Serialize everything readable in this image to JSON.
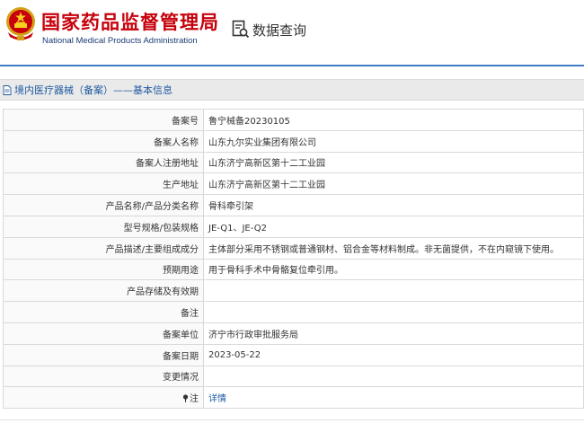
{
  "header": {
    "org_name_cn": "国家药品监督管理局",
    "org_name_en": "National Medical Products Administration",
    "query_label": "数据查询",
    "colors": {
      "brand_red": "#c7000b",
      "brand_blue": "#1a3a73",
      "divider": "#3e7dc3"
    },
    "emblem_icon": "national-emblem-icon",
    "query_icon": "document-search-icon"
  },
  "section": {
    "title": "境内医疗器械（备案）——基本信息",
    "icon": "document-icon"
  },
  "rows": [
    {
      "label": "备案号",
      "value": "鲁宁械备20230105"
    },
    {
      "label": "备案人名称",
      "value": "山东九尔实业集团有限公司"
    },
    {
      "label": "备案人注册地址",
      "value": "山东济宁高新区第十二工业园"
    },
    {
      "label": "生产地址",
      "value": "山东济宁高新区第十二工业园"
    },
    {
      "label": "产品名称/产品分类名称",
      "value": "骨科牵引架"
    },
    {
      "label": "型号规格/包装规格",
      "value": "JE-Q1、JE-Q2"
    },
    {
      "label": "产品描述/主要组成成分",
      "value": "主体部分采用不锈钢或普通钢材、铝合金等材料制成。非无菌提供，不在内窥镜下使用。"
    },
    {
      "label": "预期用途",
      "value": "用于骨科手术中骨骼复位牵引用。"
    },
    {
      "label": "产品存储及有效期",
      "value": ""
    },
    {
      "label": "备注",
      "value": ""
    },
    {
      "label": "备案单位",
      "value": "济宁市行政审批服务局"
    },
    {
      "label": "备案日期",
      "value": "2023-05-22"
    },
    {
      "label": "变更情况",
      "value": ""
    },
    {
      "label": "注",
      "value": "详情",
      "icon": "pin-icon"
    }
  ]
}
